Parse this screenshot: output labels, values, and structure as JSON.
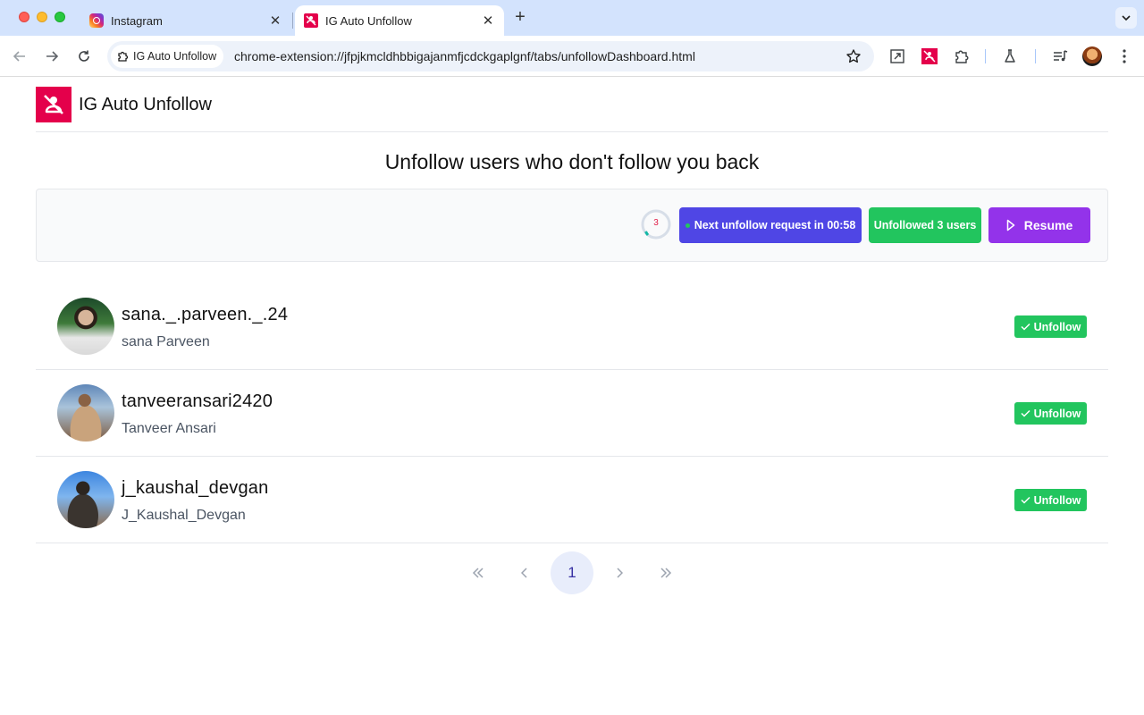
{
  "browser": {
    "tabs": [
      {
        "title": "Instagram",
        "favicon": "instagram-icon",
        "active": false
      },
      {
        "title": "IG Auto Unfollow",
        "favicon": "extension-icon",
        "active": true
      }
    ],
    "site_chip": "IG Auto Unfollow",
    "url": "chrome-extension://jfpjkmcldhbbigajanmfjcdckgaplgnf/tabs/unfollowDashboard.html"
  },
  "app": {
    "title": "IG Auto Unfollow",
    "brand_color": "#e4004b"
  },
  "dashboard": {
    "headline": "Unfollow users who don't follow you back",
    "progress_count": "3",
    "timer_label": "Next unfollow request in 00:58",
    "unfollowed_label": "Unfollowed 3 users",
    "resume_label": "Resume",
    "colors": {
      "timer": "#4f46e5",
      "success": "#22c55e",
      "resume": "#9333ea"
    }
  },
  "users": [
    {
      "handle": "sana._.parveen._.24",
      "name": "sana Parveen",
      "status": "Unfollow"
    },
    {
      "handle": "tanveeransari2420",
      "name": "Tanveer Ansari",
      "status": "Unfollow"
    },
    {
      "handle": "j_kaushal_devgan",
      "name": "J_Kaushal_Devgan",
      "status": "Unfollow"
    }
  ],
  "pagination": {
    "first": "«",
    "prev": "‹",
    "current": "1",
    "next": "›",
    "last": "»"
  }
}
